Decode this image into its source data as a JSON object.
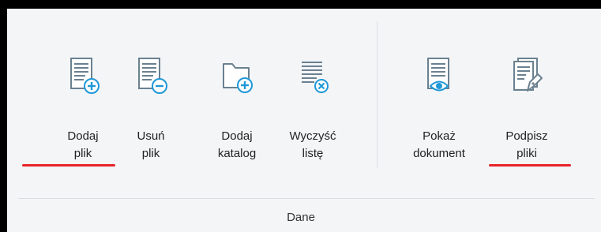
{
  "ribbon": {
    "group_label": "Dane",
    "buttons": [
      {
        "label_line1": "Dodaj",
        "label_line2": "plik",
        "icon": "document-add-icon"
      },
      {
        "label_line1": "Usuń",
        "label_line2": "plik",
        "icon": "document-remove-icon"
      },
      {
        "label_line1": "Dodaj",
        "label_line2": "katalog",
        "icon": "folder-add-icon"
      },
      {
        "label_line1": "Wyczyść",
        "label_line2": "listę",
        "icon": "list-clear-icon"
      },
      {
        "label_line1": "Pokaż",
        "label_line2": "dokument",
        "icon": "document-view-icon"
      },
      {
        "label_line1": "Podpisz",
        "label_line2": "pliki",
        "icon": "document-sign-icon"
      }
    ]
  },
  "colors": {
    "icon_stroke": "#6b8190",
    "icon_accent": "#1f98d8",
    "underline": "#e8232a"
  }
}
